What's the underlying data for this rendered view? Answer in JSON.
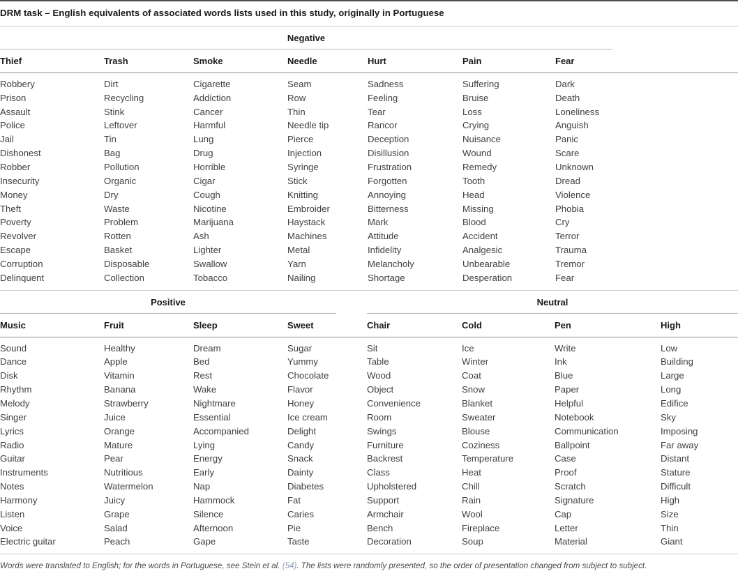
{
  "caption": "DRM task – English equivalents of associated words lists used in this study, originally in Portuguese",
  "groups": {
    "negative": "Negative",
    "positive": "Positive",
    "neutral": "Neutral"
  },
  "negative": {
    "columns": [
      {
        "header": "Thief",
        "words": [
          "Robbery",
          "Prison",
          "Assault",
          "Police",
          "Jail",
          "Dishonest",
          "Robber",
          "Insecurity",
          "Money",
          "Theft",
          "Poverty",
          "Revolver",
          "Escape",
          "Corruption",
          "Delinquent"
        ]
      },
      {
        "header": "Trash",
        "words": [
          "Dirt",
          "Recycling",
          "Stink",
          "Leftover",
          "Tin",
          "Bag",
          "Pollution",
          "Organic",
          "Dry",
          "Waste",
          "Problem",
          "Rotten",
          "Basket",
          "Disposable",
          "Collection"
        ]
      },
      {
        "header": "Smoke",
        "words": [
          "Cigarette",
          "Addiction",
          "Cancer",
          "Harmful",
          "Lung",
          "Drug",
          "Horrible",
          "Cigar",
          "Cough",
          "Nicotine",
          "Marijuana",
          "Ash",
          "Lighter",
          "Swallow",
          "Tobacco"
        ]
      },
      {
        "header": "Needle",
        "words": [
          "Seam",
          "Row",
          "Thin",
          "Needle tip",
          "Pierce",
          "Injection",
          "Syringe",
          "Stick",
          "Knitting",
          "Embroider",
          "Haystack",
          "Machines",
          "Metal",
          "Yarn",
          "Nailing"
        ]
      },
      {
        "header": "Hurt",
        "words": [
          "Sadness",
          "Feeling",
          "Tear",
          "Rancor",
          "Deception",
          "Disillusion",
          "Frustration",
          "Forgotten",
          "Annoying",
          "Bitterness",
          "Mark",
          "Attitude",
          "Infidelity",
          "Melancholy",
          "Shortage"
        ]
      },
      {
        "header": "Pain",
        "words": [
          "Suffering",
          "Bruise",
          "Loss",
          "Crying",
          "Nuisance",
          "Wound",
          "Remedy",
          "Tooth",
          "Head",
          "Missing",
          "Blood",
          "Accident",
          "Analgesic",
          "Unbearable",
          "Desperation"
        ]
      },
      {
        "header": "Fear",
        "words": [
          "Dark",
          "Death",
          "Loneliness",
          "Anguish",
          "Panic",
          "Scare",
          "Unknown",
          "Dread",
          "Violence",
          "Phobia",
          "Cry",
          "Terror",
          "Trauma",
          "Tremor",
          "Fear"
        ]
      }
    ]
  },
  "positive": {
    "columns": [
      {
        "header": "Music",
        "words": [
          "Sound",
          "Dance",
          "Disk",
          "Rhythm",
          "Melody",
          "Singer",
          "Lyrics",
          "Radio",
          "Guitar",
          "Instruments",
          "Notes",
          "Harmony",
          "Listen",
          "Voice",
          "Electric guitar"
        ]
      },
      {
        "header": "Fruit",
        "words": [
          "Healthy",
          "Apple",
          "Vitamin",
          "Banana",
          "Strawberry",
          "Juice",
          "Orange",
          "Mature",
          "Pear",
          "Nutritious",
          "Watermelon",
          "Juicy",
          "Grape",
          "Salad",
          "Peach"
        ]
      },
      {
        "header": "Sleep",
        "words": [
          "Dream",
          "Bed",
          "Rest",
          "Wake",
          "Nightmare",
          "Essential",
          "Accompanied",
          "Lying",
          "Energy",
          "Early",
          "Nap",
          "Hammock",
          "Silence",
          "Afternoon",
          "Gape"
        ]
      },
      {
        "header": "Sweet",
        "words": [
          "Sugar",
          "Yummy",
          "Chocolate",
          "Flavor",
          "Honey",
          "Ice cream",
          "Delight",
          "Candy",
          "Snack",
          "Dainty",
          "Diabetes",
          "Fat",
          "Caries",
          "Pie",
          "Taste"
        ]
      }
    ]
  },
  "neutral": {
    "columns": [
      {
        "header": "Chair",
        "words": [
          "Sit",
          "Table",
          "Wood",
          "Object",
          "Convenience",
          "Room",
          "Swings",
          "Furniture",
          "Backrest",
          "Class",
          "Upholstered",
          "Support",
          "Armchair",
          "Bench",
          "Decoration"
        ]
      },
      {
        "header": "Cold",
        "words": [
          "Ice",
          "Winter",
          "Coat",
          "Snow",
          "Blanket",
          "Sweater",
          "Blouse",
          "Coziness",
          "Temperature",
          "Heat",
          "Chill",
          "Rain",
          "Wool",
          "Fireplace",
          "Soup"
        ]
      },
      {
        "header": "Pen",
        "words": [
          "Write",
          "Ink",
          "Blue",
          "Paper",
          "Helpful",
          "Notebook",
          "Communication",
          "Ballpoint",
          "Case",
          "Proof",
          "Scratch",
          "Signature",
          "Cap",
          "Letter",
          "Material"
        ]
      },
      {
        "header": "High",
        "words": [
          "Low",
          "Building",
          "Large",
          "Long",
          "Edifice",
          "Sky",
          "Imposing",
          "Far away",
          "Distant",
          "Stature",
          "Difficult",
          "High",
          "Size",
          "Thin",
          "Giant"
        ]
      }
    ]
  },
  "footnote": {
    "before": "Words were translated to English; for the words in Portuguese, see Stein et al. ",
    "citation": "(54)",
    "after": ". The lists were randomly presented, so the order of presentation changed from subject to subject."
  },
  "colors": {
    "rule_strong": "#4d4d4d",
    "rule_light": "#c9c9c9",
    "heading_text": "#1a1a1a",
    "body_text": "#3f3f3f",
    "citation_link": "#8d9db6"
  }
}
